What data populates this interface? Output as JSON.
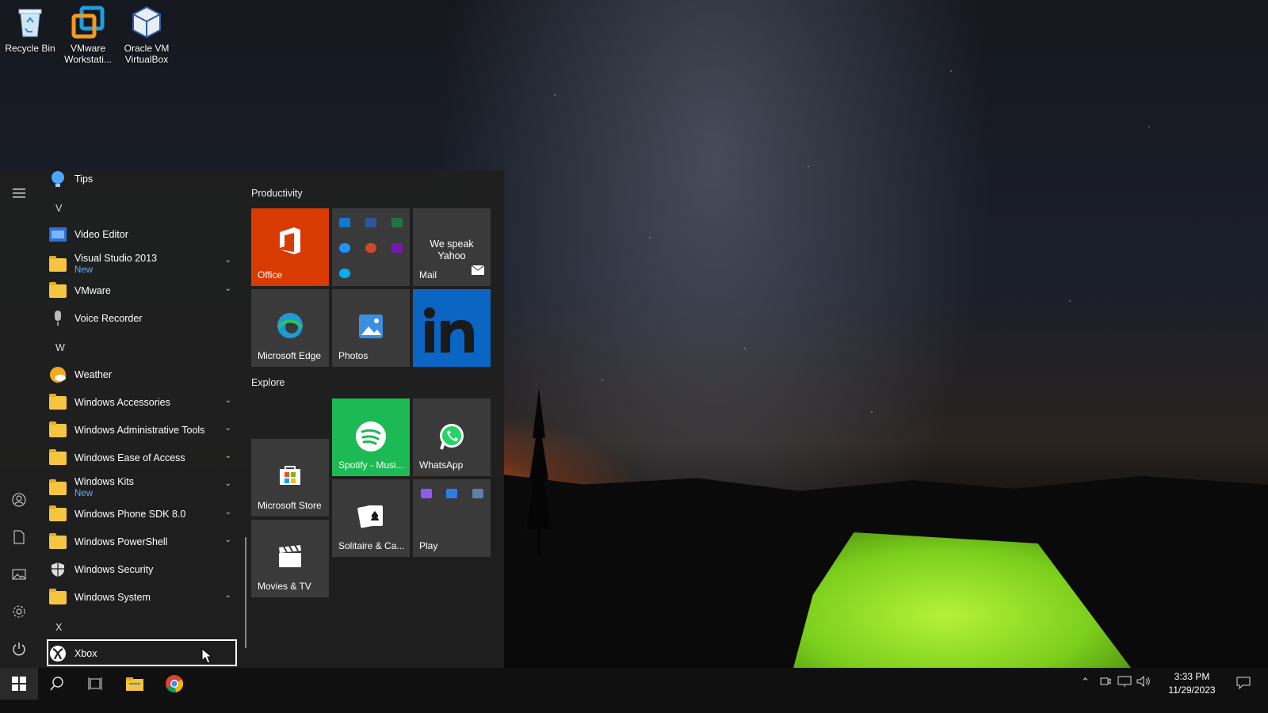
{
  "desktop": {
    "icons": [
      {
        "label": "Recycle Bin"
      },
      {
        "label": "VMware\nWorkstati..."
      },
      {
        "label": "Oracle VM\nVirtualBox"
      }
    ]
  },
  "start_menu": {
    "apps": {
      "tips": "Tips",
      "letter_v": "V",
      "video_editor": "Video Editor",
      "visual_studio": "Visual Studio 2013",
      "visual_studio_sub": "New",
      "vmware": "VMware",
      "voice_recorder": "Voice Recorder",
      "letter_w": "W",
      "weather": "Weather",
      "win_accessories": "Windows Accessories",
      "win_admin_tools": "Windows Administrative Tools",
      "win_ease": "Windows Ease of Access",
      "win_kits": "Windows Kits",
      "win_kits_sub": "New",
      "win_phone_sdk": "Windows Phone SDK 8.0",
      "win_powershell": "Windows PowerShell",
      "win_security": "Windows Security",
      "win_system": "Windows System",
      "letter_x": "X",
      "xbox": "Xbox"
    },
    "groups": {
      "productivity": "Productivity",
      "explore": "Explore"
    },
    "tiles": {
      "office": "Office",
      "mail": "Mail",
      "mail_text": "We speak Yahoo",
      "edge": "Microsoft Edge",
      "photos": "Photos",
      "spotify": "Spotify - Musi...",
      "whatsapp": "WhatsApp",
      "store": "Microsoft Store",
      "solitaire": "Solitaire & Ca...",
      "play": "Play",
      "movies": "Movies & TV"
    },
    "colors": {
      "office": "#d83b01",
      "linkedin": "#0a66c2",
      "spotify": "#1db954",
      "tile_bg": "#3a3a3a"
    }
  },
  "taskbar": {
    "time": "3:33 PM",
    "date": "11/29/2023"
  }
}
